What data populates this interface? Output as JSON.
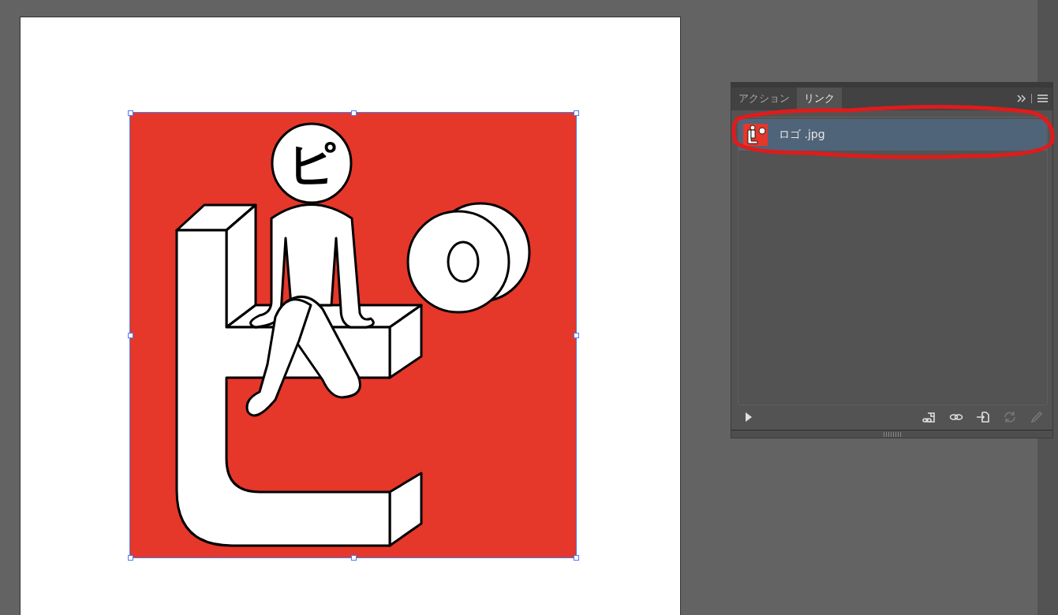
{
  "artboard": {
    "artwork": {
      "head_text": "ピ",
      "selected": true
    }
  },
  "panel": {
    "tabs": [
      {
        "label": "アクション",
        "selected": false
      },
      {
        "label": "リンク",
        "selected": true
      }
    ],
    "links": [
      {
        "name": "ロゴ .jpg",
        "selected": true
      }
    ],
    "footer_buttons": [
      {
        "kind": "relink",
        "disabled": false
      },
      {
        "kind": "goto",
        "disabled": false
      },
      {
        "kind": "embed",
        "disabled": false
      },
      {
        "kind": "update",
        "disabled": true
      },
      {
        "kind": "edit",
        "disabled": true
      }
    ]
  }
}
